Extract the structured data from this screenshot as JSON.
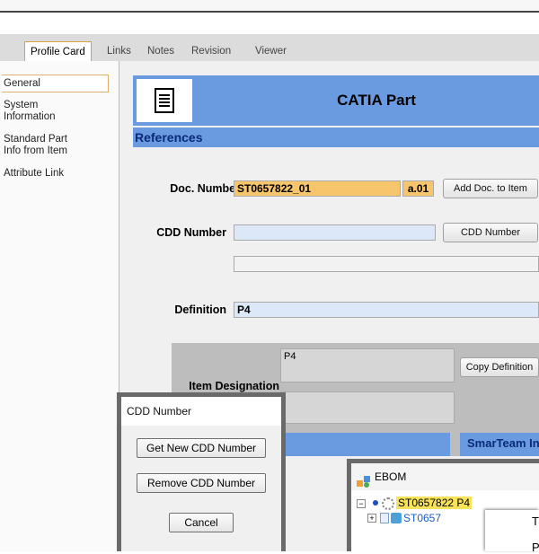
{
  "tabs": [
    {
      "label": "Profile Card",
      "active": true
    },
    {
      "label": "Links"
    },
    {
      "label": "Notes"
    },
    {
      "label": "Revision"
    },
    {
      "label": "Viewer"
    }
  ],
  "sidebar": {
    "items": [
      {
        "label": "General",
        "selected": true
      },
      {
        "label": "System\nInformation"
      },
      {
        "label": "Standard Part\nInfo from Item"
      },
      {
        "label": "Attribute Link"
      }
    ]
  },
  "header": {
    "icon": "document-icon",
    "title": "CATIA Part"
  },
  "references": {
    "label": "References"
  },
  "doc_number": {
    "label": "Doc. Number",
    "value": "ST0657822_01",
    "revision": "a.01",
    "button": "Add Doc. to Item"
  },
  "cdd_number": {
    "label": "CDD Number",
    "value": "",
    "button": "CDD Number",
    "extra_value": ""
  },
  "definition": {
    "label": "Definition",
    "value": "P4"
  },
  "item_designation": {
    "label": "Item Designation",
    "value": "P4",
    "button": "Copy Definition"
  },
  "cdd_dialog": {
    "title": "CDD Number",
    "get_button": "Get New CDD Number",
    "remove_button": "Remove CDD Number",
    "cancel_button": "Cancel"
  },
  "partial_header": "SmarTeam In",
  "ebom": {
    "title": "EBOM",
    "root": "ST0657822 P4",
    "child": "ST0657",
    "popup_text": [
      "T",
      "P"
    ]
  },
  "colors": {
    "header_blue": "#6a9be0",
    "doc_field": "#f7c56c",
    "cdd_field": "#dce8f7",
    "def_field": "#dce8f7"
  }
}
